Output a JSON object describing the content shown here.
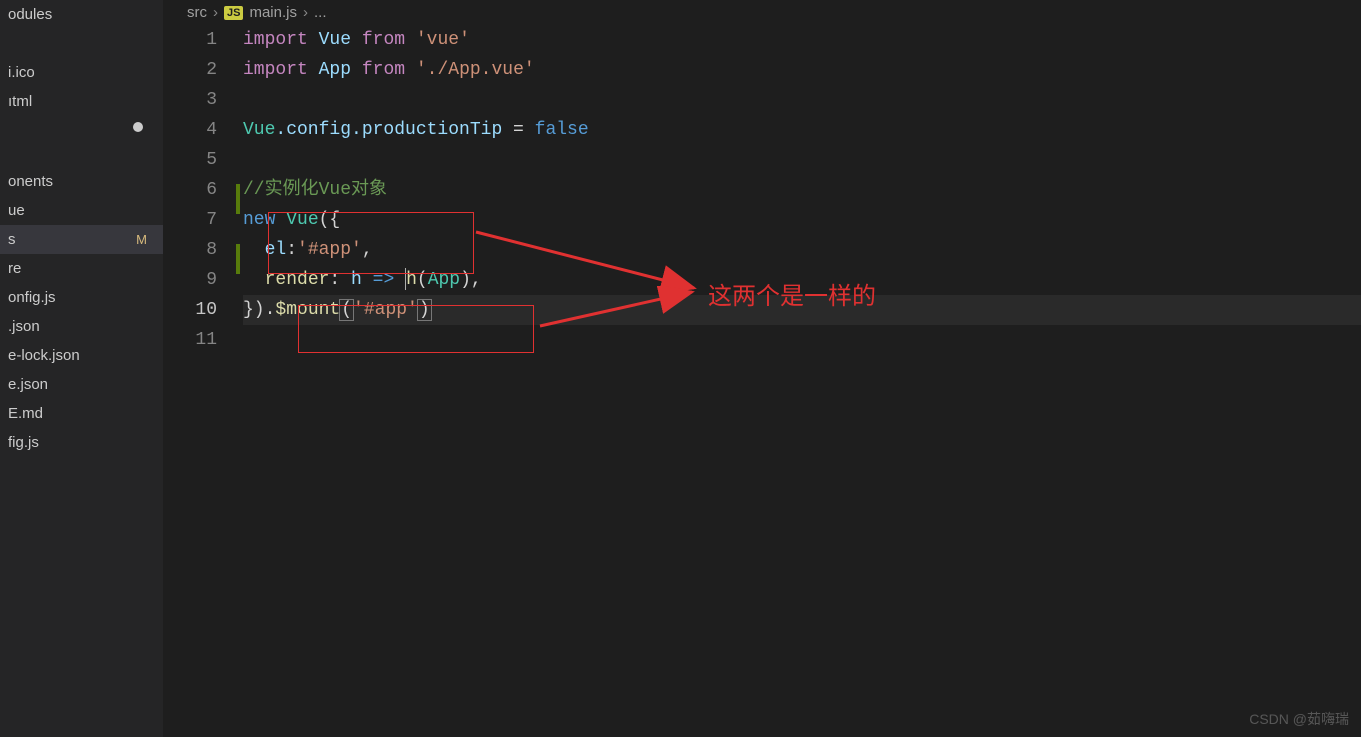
{
  "sidebar": {
    "items": [
      {
        "label": "odules",
        "modified": false
      },
      {
        "label": "",
        "modified": false,
        "blank": true
      },
      {
        "label": "i.ico",
        "modified": false
      },
      {
        "label": "ıtml",
        "modified": false
      },
      {
        "label": "",
        "modified": false,
        "dirty": true
      },
      {
        "label": "",
        "modified": false,
        "blank": true
      },
      {
        "label": "onents",
        "modified": false
      },
      {
        "label": "ue",
        "modified": false
      },
      {
        "label": "s",
        "modified": true,
        "selected": true,
        "badge": "M"
      },
      {
        "label": "re",
        "modified": false
      },
      {
        "label": "onfig.js",
        "modified": false
      },
      {
        "label": ".json",
        "modified": false
      },
      {
        "label": "e-lock.json",
        "modified": false
      },
      {
        "label": "e.json",
        "modified": false
      },
      {
        "label": "E.md",
        "modified": false
      },
      {
        "label": "fig.js",
        "modified": false
      }
    ]
  },
  "breadcrumb": {
    "seg1": "src",
    "js_badge": "JS",
    "seg2": "main.js",
    "seg3": "..."
  },
  "code": {
    "line1": {
      "t_import": "import",
      "t_Vue": "Vue",
      "t_from": "from",
      "t_str": "'vue'"
    },
    "line2": {
      "t_import": "import",
      "t_App": "App",
      "t_from": "from",
      "t_str": "'./App.vue'"
    },
    "line4": {
      "t_Vue": "Vue",
      "t_config": ".config.productionTip",
      "t_eq": " = ",
      "t_false": "false"
    },
    "line6": {
      "t_comment": "//实例化Vue对象"
    },
    "line7": {
      "t_new": "new",
      "t_Vue": "Vue",
      "t_open": "({"
    },
    "line8": {
      "t_el": "el",
      "t_colon": ":",
      "t_str": "'#app'",
      "t_comma": ","
    },
    "line9": {
      "t_render": "render",
      "t_colon": ": ",
      "t_h": "h",
      "t_arrow": " => ",
      "t_h2": "h",
      "t_open": "(",
      "t_App": "App",
      "t_close": ")",
      "t_comma": ","
    },
    "line10": {
      "t_close": "})",
      "t_dot": ".",
      "t_mount": "$mount",
      "t_open": "(",
      "t_str": "'#app'",
      "t_closep": ")"
    }
  },
  "line_numbers": [
    "1",
    "2",
    "3",
    "4",
    "5",
    "6",
    "7",
    "8",
    "9",
    "10",
    "11"
  ],
  "active_line_index": 9,
  "annotation": {
    "text": "这两个是一样的"
  },
  "watermark": "CSDN @茹嗨瑞"
}
